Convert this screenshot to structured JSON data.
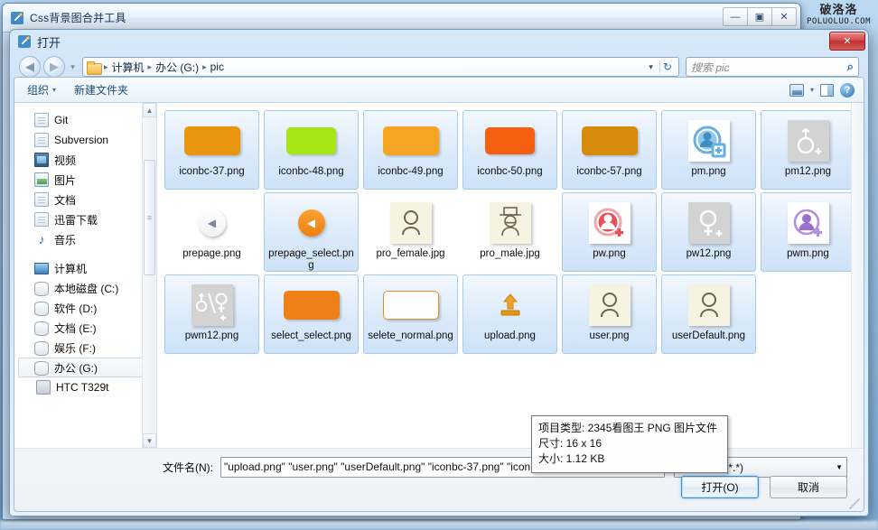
{
  "background_window": {
    "title": "Css背景图合并工具",
    "icon": "app-pencil-icon",
    "minimize_label": "—",
    "maximize_label": "▣",
    "close_label": "✕"
  },
  "watermark": {
    "cn": "破洛洛",
    "en": "POLUOLUO.COM"
  },
  "red_close_label": "✕",
  "dialog": {
    "title": "打开",
    "nav": {
      "back_label": "◀",
      "forward_label": "▶",
      "history_label": "▾",
      "refresh_label": "↻",
      "address_dropdown_label": "▾"
    },
    "breadcrumb": {
      "items": [
        "计算机",
        "办公 (G:)",
        "pic"
      ],
      "separator": "▸"
    },
    "search": {
      "placeholder": "搜索 pic",
      "icon": "search-icon"
    },
    "toolbar": {
      "organize_label": "组织",
      "organize_caret": "▾",
      "new_folder_label": "新建文件夹",
      "view_caret": "▾",
      "help_label": "?"
    },
    "navpane": {
      "items": [
        {
          "label": "Git",
          "icon": "doc-icon",
          "group": false,
          "selected": false
        },
        {
          "label": "Subversion",
          "icon": "doc-icon",
          "group": false,
          "selected": false
        },
        {
          "label": "视频",
          "icon": "video-icon",
          "group": false,
          "selected": false
        },
        {
          "label": "图片",
          "icon": "picture-icon",
          "group": false,
          "selected": false
        },
        {
          "label": "文档",
          "icon": "doc-icon",
          "group": false,
          "selected": false
        },
        {
          "label": "迅雷下载",
          "icon": "doc-icon",
          "group": false,
          "selected": false
        },
        {
          "label": "音乐",
          "icon": "music-icon",
          "group": false,
          "selected": false
        },
        {
          "label": "计算机",
          "icon": "computer-icon",
          "group": true,
          "selected": false
        },
        {
          "label": "本地磁盘 (C:)",
          "icon": "system-drive-icon",
          "group": false,
          "selected": false
        },
        {
          "label": "软件 (D:)",
          "icon": "drive-icon",
          "group": false,
          "selected": false
        },
        {
          "label": "文档 (E:)",
          "icon": "drive-icon",
          "group": false,
          "selected": false
        },
        {
          "label": "娱乐 (F:)",
          "icon": "drive-icon",
          "group": false,
          "selected": false
        },
        {
          "label": "办公 (G:)",
          "icon": "drive-icon",
          "group": false,
          "selected": true
        },
        {
          "label": "HTC T329t",
          "icon": "phone-icon",
          "group": false,
          "selected": false
        }
      ],
      "scroll_up": "▲",
      "scroll_down": "▼"
    },
    "files": [
      {
        "label": "iconbc-37.png",
        "thumb": "bar",
        "color": "#e8960f",
        "selected": true
      },
      {
        "label": "iconbc-48.png",
        "thumb": "bar",
        "color": "#a6e713",
        "selected": true
      },
      {
        "label": "iconbc-49.png",
        "thumb": "bar",
        "color": "#f5a524",
        "selected": true
      },
      {
        "label": "iconbc-50.png",
        "thumb": "bar",
        "color": "#f4600f",
        "selected": true
      },
      {
        "label": "iconbc-57.png",
        "thumb": "bar",
        "color": "#d68b0c",
        "selected": true
      },
      {
        "label": "pm.png",
        "thumb": "person-add-blue",
        "color": "#6ab0dc",
        "selected": true
      },
      {
        "label": "pm12.png",
        "thumb": "male-add-gray",
        "color": "#ffffff",
        "selected": true
      },
      {
        "label": "prepage.png",
        "thumb": "arrow-left-white",
        "color": "#ffffff",
        "selected": false
      },
      {
        "label": "prepage_select.png",
        "thumb": "arrow-left-orange",
        "color": "#ef7f10",
        "selected": true
      },
      {
        "label": "pro_female.jpg",
        "thumb": "female-outline",
        "color": "#6f6356",
        "selected": false
      },
      {
        "label": "pro_male.jpg",
        "thumb": "male-hat-outline",
        "color": "#6f6356",
        "selected": false
      },
      {
        "label": "pw.png",
        "thumb": "person-add-red",
        "color": "#e8505a",
        "selected": true
      },
      {
        "label": "pw12.png",
        "thumb": "female-add-gray",
        "color": "#ffffff",
        "selected": true
      },
      {
        "label": "pwm.png",
        "thumb": "person-add-purple",
        "color": "#a47bd0",
        "selected": true
      },
      {
        "label": "pwm12.png",
        "thumb": "both-add-gray",
        "color": "#ffffff",
        "selected": true
      },
      {
        "label": "select_select.png",
        "thumb": "bar",
        "color": "#ef8018",
        "selected": true
      },
      {
        "label": "selete_normal.png",
        "thumb": "bar-outline",
        "color": "#e08c2a",
        "selected": true
      },
      {
        "label": "upload.png",
        "thumb": "upload-icon",
        "color": "#e8960f",
        "selected": true
      },
      {
        "label": "user.png",
        "thumb": "person-outline",
        "color": "#6f6356",
        "selected": true
      },
      {
        "label": "userDefault.png",
        "thumb": "person-outline",
        "color": "#6f6356",
        "selected": true
      }
    ],
    "tooltip": {
      "line1": "项目类型: 2345看图王 PNG 图片文件",
      "line2": "尺寸: 16 x 16",
      "line3": "大小: 1.12 KB"
    },
    "bottom": {
      "filename_label": "文件名(N):",
      "filename_value": "\"upload.png\" \"user.png\" \"userDefault.png\" \"iconbc-37.png\" \"iconbc-48.png\" \"iconbc-49.",
      "filename_caret": "▼",
      "filter_value": "所有文件 (*.*)",
      "filter_caret": "▼",
      "open_button": "打开(O)",
      "cancel_button": "取消"
    }
  }
}
